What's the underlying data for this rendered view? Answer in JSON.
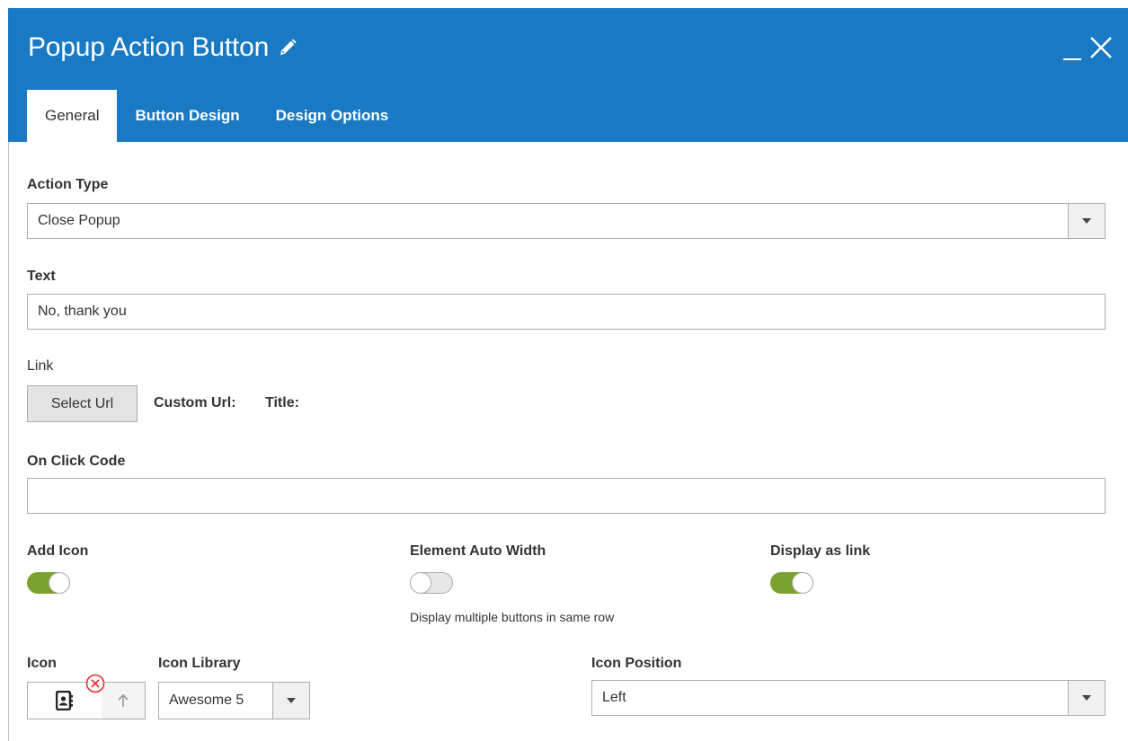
{
  "dialog": {
    "title": "Popup Action Button",
    "tabs": [
      {
        "label": "General"
      },
      {
        "label": "Button Design"
      },
      {
        "label": "Design Options"
      }
    ]
  },
  "form": {
    "action_type": {
      "label": "Action Type",
      "value": "Close Popup"
    },
    "text": {
      "label": "Text",
      "value": "No, thank you"
    },
    "link": {
      "label": "Link",
      "button": "Select Url",
      "custom_url": "Custom Url:",
      "title": "Title:"
    },
    "on_click": {
      "label": "On Click Code",
      "value": ""
    },
    "add_icon": {
      "label": "Add Icon",
      "on": true
    },
    "auto_width": {
      "label": "Element Auto Width",
      "on": false,
      "note": "Display multiple buttons in same row"
    },
    "display_link": {
      "label": "Display as link",
      "on": true
    },
    "icon": {
      "label": "Icon",
      "name": "address-book-icon"
    },
    "icon_library": {
      "label": "Icon Library",
      "value": "Awesome 5"
    },
    "icon_position": {
      "label": "Icon Position",
      "value": "Left"
    }
  },
  "colors": {
    "header": "#1979c3",
    "toggle_on": "#79a22e",
    "remove": "#e22626"
  }
}
